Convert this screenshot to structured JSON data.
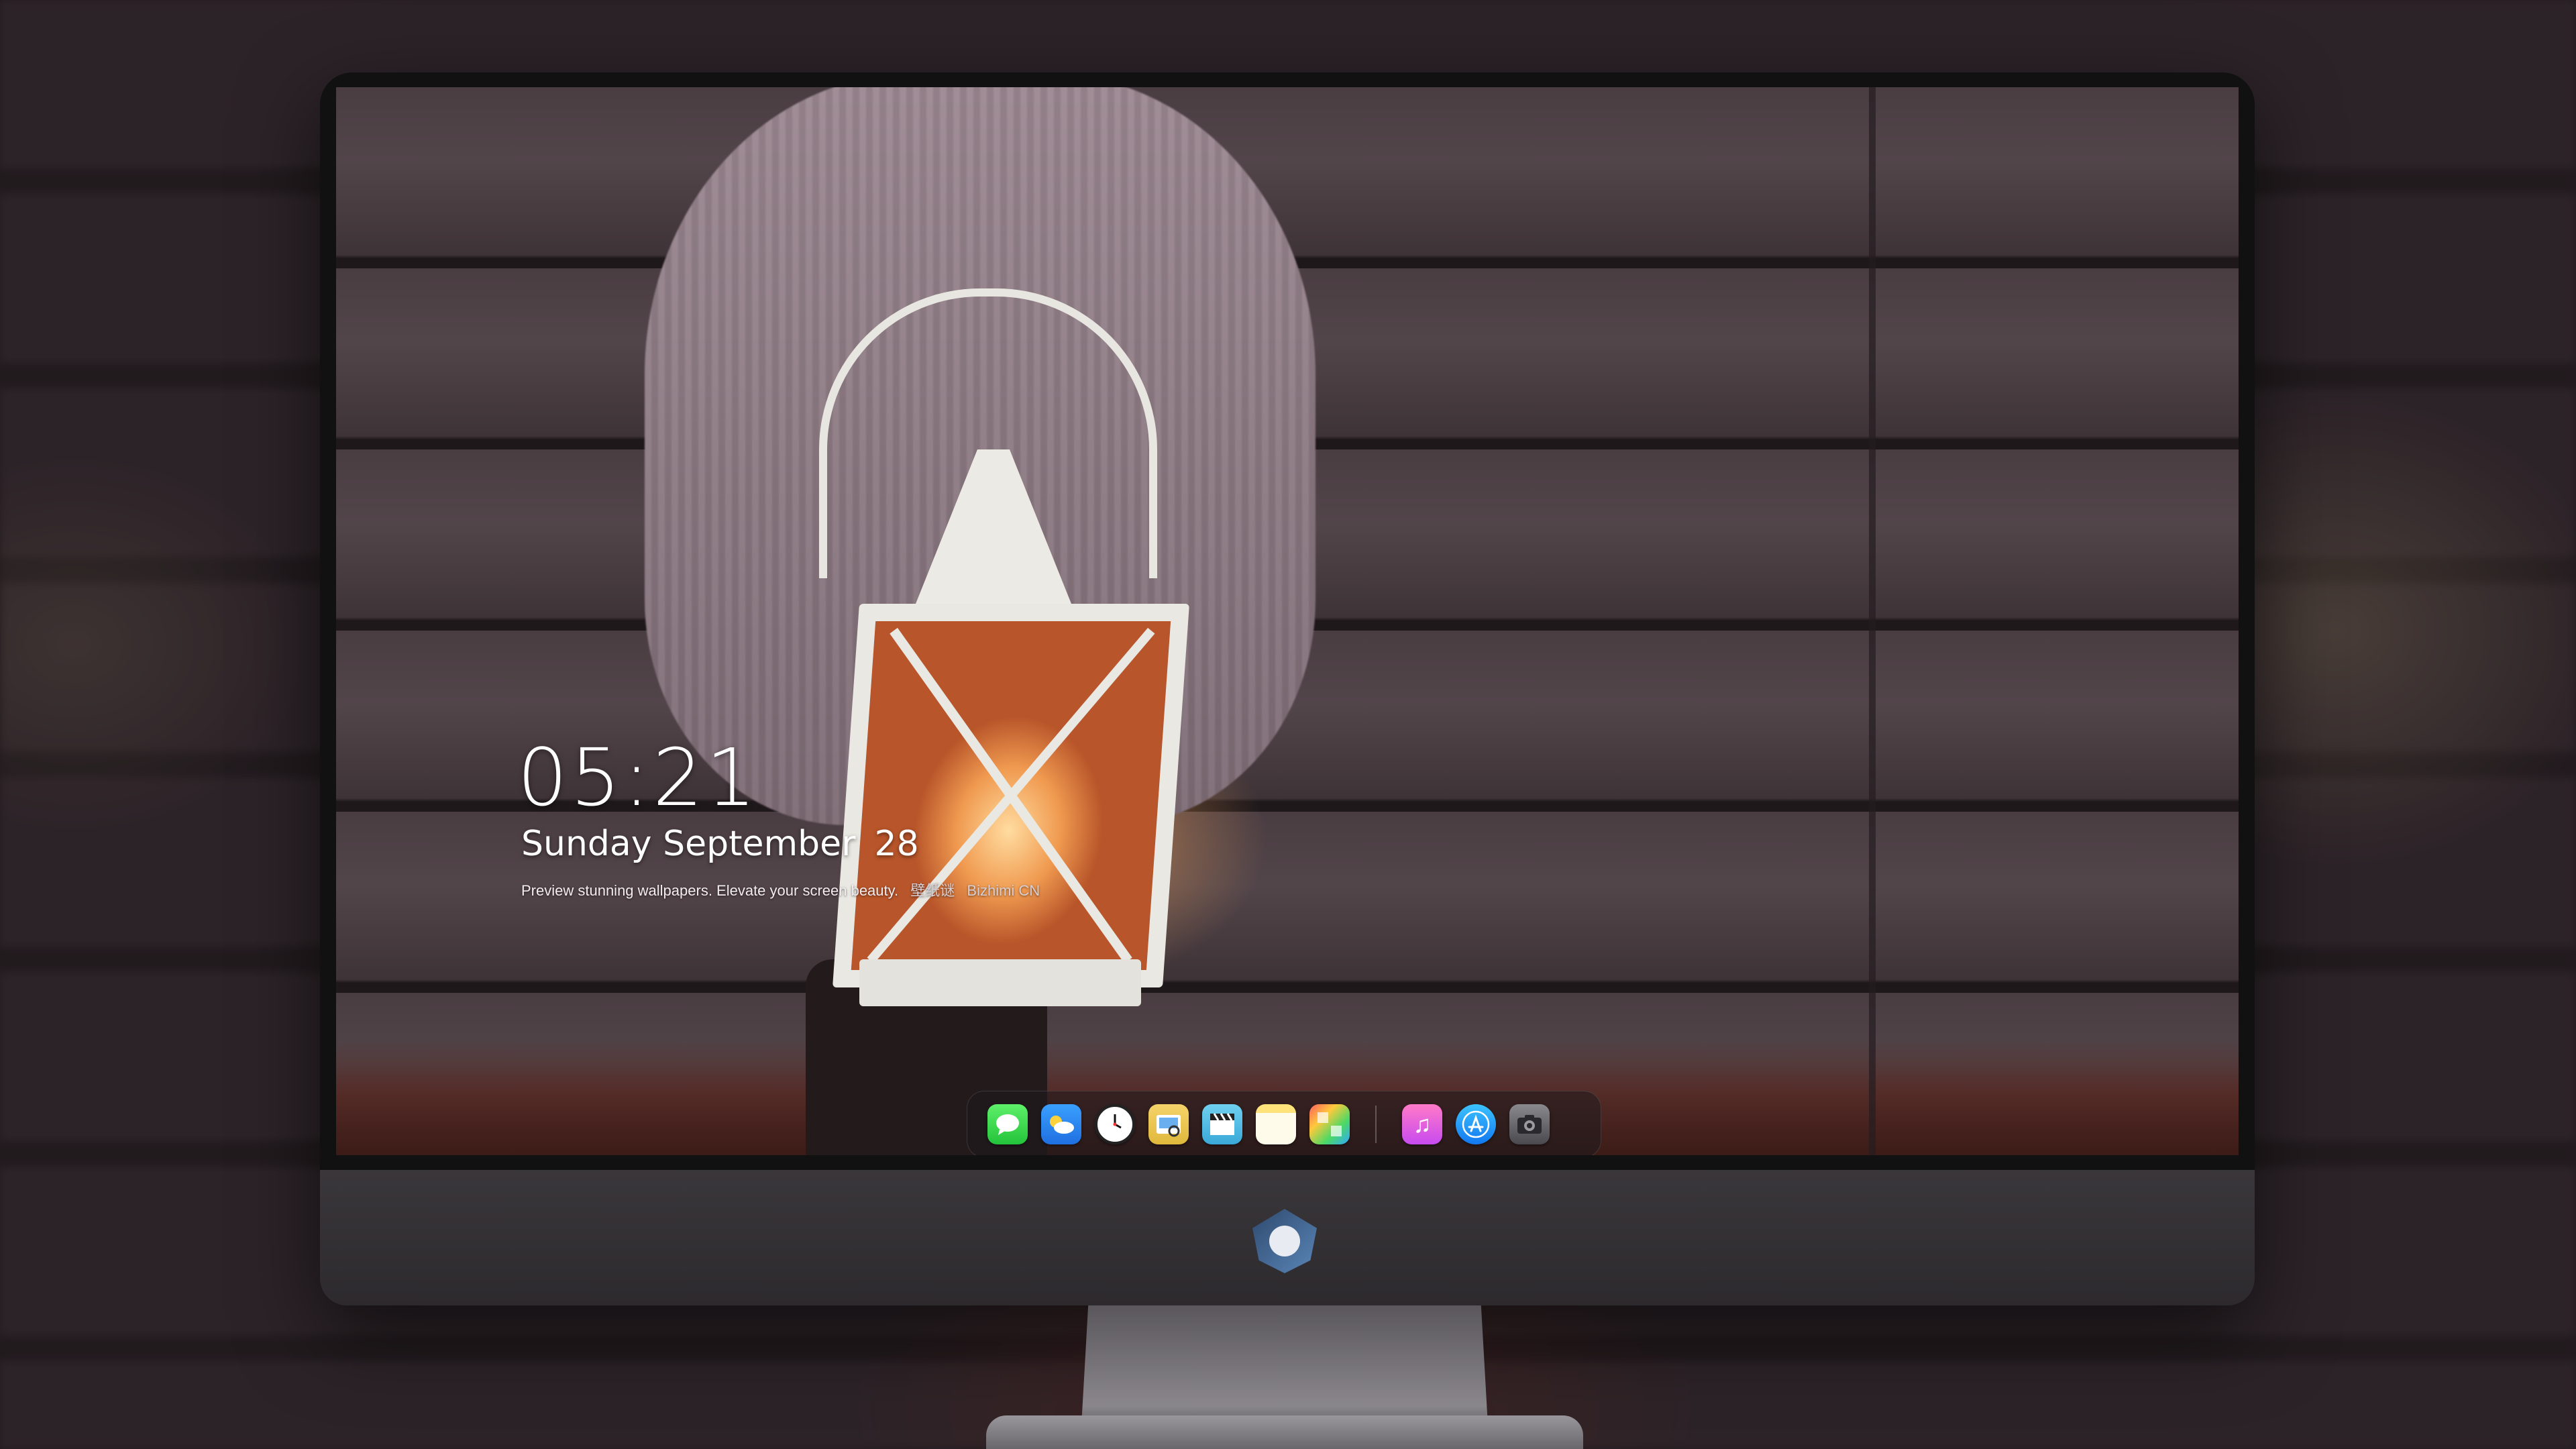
{
  "lockscreen": {
    "time": "05:21",
    "day": "Sunday",
    "month": "September",
    "date": "28",
    "tagline": "Preview stunning wallpapers. Elevate your screen beauty.",
    "brand_cn": "壁纸谜",
    "brand": "Bizhimi CN"
  },
  "dock": {
    "apps": [
      {
        "name": "messages-icon",
        "color": "#34c759"
      },
      {
        "name": "weather-icon",
        "color": "#2f8cff"
      },
      {
        "name": "clock-icon",
        "color": "#ffffff"
      },
      {
        "name": "preview-icon",
        "color": "#f0c94a"
      },
      {
        "name": "clips-icon",
        "color": "#4fbbe6"
      },
      {
        "name": "notes-icon",
        "color": "#ffe27a"
      },
      {
        "name": "photos-icon",
        "color": "#ff9f0a"
      },
      {
        "name": "music-icon",
        "color": "#e45bd8"
      },
      {
        "name": "app-store-icon",
        "color": "#1a8cff"
      },
      {
        "name": "camera-icon",
        "color": "#6a6a6e"
      }
    ]
  }
}
